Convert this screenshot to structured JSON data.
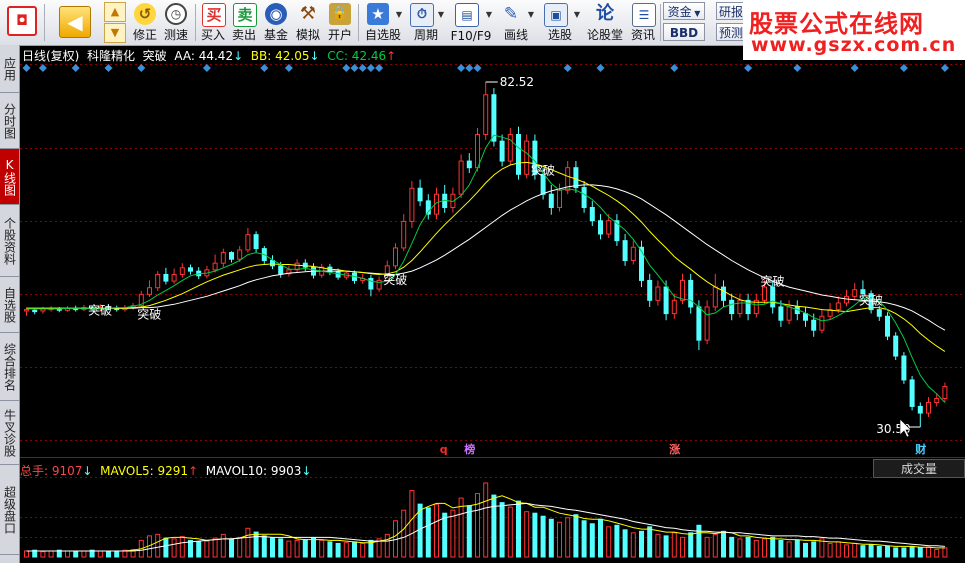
{
  "toolbar": {
    "items": [
      {
        "id": "back",
        "label": ""
      },
      {
        "id": "fix",
        "label": "修正"
      },
      {
        "id": "speed",
        "label": "测速"
      },
      {
        "id": "buy",
        "label": "买入",
        "glyph": "买"
      },
      {
        "id": "sell",
        "label": "卖出",
        "glyph": "卖"
      },
      {
        "id": "fund",
        "label": "基金"
      },
      {
        "id": "sim",
        "label": "模拟"
      },
      {
        "id": "open",
        "label": "开户"
      },
      {
        "id": "watch",
        "label": "自选股"
      },
      {
        "id": "period",
        "label": "周期"
      },
      {
        "id": "f10",
        "label": "F10/F9"
      },
      {
        "id": "draw",
        "label": "画线"
      },
      {
        "id": "pick",
        "label": "选股"
      },
      {
        "id": "forum",
        "label": "论股堂",
        "glyph": "论"
      },
      {
        "id": "news",
        "label": "资讯"
      }
    ],
    "funds_label": "资金",
    "bbd_label": "BBD",
    "research_label": "研报",
    "forecast_label": "预测"
  },
  "brand": {
    "title": "股票公式在线网",
    "url": "www.gszx.com.cn"
  },
  "sidebar": {
    "tabs": [
      {
        "label": "应用"
      },
      {
        "label": "分时图"
      },
      {
        "label": "K线图",
        "active": true
      },
      {
        "label": "个股资料"
      },
      {
        "label": "自选股"
      },
      {
        "label": "综合排名"
      },
      {
        "label": "牛叉诊股"
      },
      {
        "label": "超级盘口"
      }
    ]
  },
  "header": {
    "period": "日线(复权)",
    "stock": "科隆精化",
    "formula": "突破",
    "aa": "AA: 44.42",
    "bb": "BB: 42.05",
    "cc": "CC: 42.46"
  },
  "volume_header": {
    "total": "总手: 9107",
    "ma5": "MAVOL5: 9291",
    "ma10": "MAVOL10: 9903"
  },
  "volume_tab": "成交量",
  "labels": {
    "high": "82.52",
    "low": "30.50",
    "breakout": "突破",
    "marker_q": "q",
    "marker_bang": "榜",
    "marker_zhang": "涨",
    "marker_cai": "财"
  },
  "colors": {
    "up": "#ff3232",
    "down": "#54ffff",
    "ma_white": "#ffffff",
    "ma_yellow": "#ffff00",
    "ma_green": "#00cc44",
    "diamond": "#3a8fd8",
    "grid": "#8b0000",
    "header_white": "#ffffff",
    "aa_color": "#ffffff",
    "bb_color": "#ffff00",
    "cc_color": "#00cc44"
  },
  "chart_data": {
    "type": "candlestick",
    "y_range": [
      30.5,
      82.52
    ],
    "high_label": 82.52,
    "low_label": 30.5,
    "candles": [
      [
        48,
        48.2,
        47.3,
        48.5
      ],
      [
        48.1,
        47.9,
        47.5,
        48.4
      ],
      [
        48,
        48.3,
        47.6,
        48.6
      ],
      [
        48.2,
        48.4,
        47.9,
        48.7
      ],
      [
        48.3,
        48.1,
        47.8,
        48.6
      ],
      [
        48.1,
        48.4,
        47.9,
        48.7
      ],
      [
        48.4,
        48.2,
        47.9,
        48.8
      ],
      [
        48.2,
        48.5,
        48,
        48.9
      ],
      [
        48.5,
        48.3,
        48,
        48.8
      ],
      [
        48.3,
        48.6,
        48,
        49
      ],
      [
        48.6,
        48.4,
        48.1,
        49
      ],
      [
        48.4,
        48.2,
        47.9,
        48.8
      ],
      [
        48.2,
        48.5,
        47.9,
        48.9
      ],
      [
        48.5,
        48.8,
        48.2,
        49.2
      ],
      [
        48.8,
        50.5,
        48.6,
        51
      ],
      [
        50.5,
        51.5,
        50.1,
        52.6
      ],
      [
        51.5,
        53.5,
        51,
        54
      ],
      [
        53.5,
        52.5,
        52,
        54.5
      ],
      [
        52.5,
        53.5,
        52.1,
        54.4
      ],
      [
        53.5,
        54.5,
        53,
        55.2
      ],
      [
        54.5,
        54,
        53.5,
        55
      ],
      [
        54,
        53.3,
        52.8,
        54.6
      ],
      [
        53.3,
        54.2,
        52.9,
        54.8
      ],
      [
        54.2,
        55.2,
        53.8,
        56.5
      ],
      [
        55.2,
        56.8,
        54.6,
        57.4
      ],
      [
        56.8,
        55.8,
        55.3,
        57
      ],
      [
        55.8,
        57.2,
        55.4,
        57.8
      ],
      [
        57.2,
        59.5,
        56.8,
        60.5
      ],
      [
        59.5,
        57.4,
        56.8,
        60
      ],
      [
        57.4,
        55.6,
        55.1,
        57.8
      ],
      [
        55.6,
        54.8,
        54.3,
        56.4
      ],
      [
        54.8,
        53.6,
        53,
        55.4
      ],
      [
        53.6,
        54.2,
        53.2,
        54.8
      ],
      [
        54.2,
        55.2,
        53.8,
        55.8
      ],
      [
        55.2,
        54.6,
        54,
        55.8
      ],
      [
        54.6,
        53.4,
        52.9,
        55.2
      ],
      [
        53.4,
        54.6,
        53,
        55.1
      ],
      [
        54.6,
        53.9,
        53.4,
        55.1
      ],
      [
        53.9,
        53.1,
        52.7,
        54.4
      ],
      [
        53.1,
        53.7,
        52.7,
        54.1
      ],
      [
        53.7,
        52.6,
        52.1,
        54.1
      ],
      [
        52.6,
        52.9,
        52.1,
        53.6
      ],
      [
        52.9,
        51.3,
        50.2,
        53.4
      ],
      [
        51.3,
        52.6,
        50.9,
        53.2
      ],
      [
        52.6,
        54.8,
        52.2,
        55.6
      ],
      [
        54.8,
        57.5,
        54.3,
        58.2
      ],
      [
        57.5,
        61.5,
        57,
        62.6
      ],
      [
        61.5,
        66.5,
        60.5,
        67.6
      ],
      [
        66.5,
        64.6,
        63.8,
        67.8
      ],
      [
        64.6,
        62.6,
        61.8,
        65.6
      ],
      [
        62.6,
        65.6,
        61.8,
        66.6
      ],
      [
        65.6,
        63.6,
        62.8,
        67
      ],
      [
        63.6,
        65.6,
        62.8,
        66.6
      ],
      [
        65.6,
        70.6,
        65,
        71.6
      ],
      [
        70.6,
        69.6,
        68.8,
        71.8
      ],
      [
        69.6,
        74.6,
        69,
        75.6
      ],
      [
        74.6,
        80.6,
        73.8,
        82.52
      ],
      [
        80.6,
        73.6,
        72.8,
        81.6
      ],
      [
        73.6,
        70.6,
        69.8,
        74.6
      ],
      [
        70.6,
        74.6,
        70,
        75.6
      ],
      [
        74.6,
        68.6,
        67.8,
        75.8
      ],
      [
        68.6,
        73.6,
        68,
        74.6
      ],
      [
        73.6,
        68.6,
        67.8,
        74.6
      ],
      [
        68.6,
        65.6,
        64.8,
        69.6
      ],
      [
        65.6,
        63.6,
        62.5,
        67
      ],
      [
        63.6,
        66.2,
        63,
        67.2
      ],
      [
        66.2,
        69.6,
        65.6,
        70.6
      ],
      [
        69.6,
        66.6,
        65.8,
        70.6
      ],
      [
        66.6,
        63.6,
        62.8,
        67.6
      ],
      [
        63.6,
        61.6,
        60.8,
        64.6
      ],
      [
        61.6,
        59.6,
        58.8,
        62.6
      ],
      [
        59.6,
        61.6,
        59,
        62.6
      ],
      [
        61.6,
        58.6,
        57.8,
        62.6
      ],
      [
        58.6,
        55.6,
        54.8,
        59.6
      ],
      [
        55.6,
        57.6,
        55,
        58.6
      ],
      [
        57.6,
        52.6,
        51.6,
        58.6
      ],
      [
        52.6,
        49.6,
        48.6,
        53.6
      ],
      [
        49.6,
        51.6,
        48.8,
        52.6
      ],
      [
        51.6,
        47.6,
        46.6,
        52.6
      ],
      [
        47.6,
        49.6,
        46.8,
        50.6
      ],
      [
        49.6,
        52.6,
        49,
        53.6
      ],
      [
        52.6,
        48.6,
        47.6,
        53.6
      ],
      [
        48.6,
        43.6,
        42.1,
        49.6
      ],
      [
        43.6,
        48.6,
        43,
        49.6
      ],
      [
        48.6,
        51.6,
        48,
        53.6
      ],
      [
        51.6,
        49.6,
        48.6,
        52.6
      ],
      [
        49.6,
        47.6,
        46.6,
        50.6
      ],
      [
        47.6,
        49.6,
        47,
        50.6
      ],
      [
        49.6,
        47.6,
        46.6,
        50.6
      ],
      [
        47.6,
        49.6,
        47,
        50.6
      ],
      [
        49.6,
        51.6,
        49,
        52.6
      ],
      [
        51.6,
        48.6,
        47.6,
        52.6
      ],
      [
        48.6,
        46.6,
        45.6,
        49.6
      ],
      [
        46.6,
        48.6,
        46,
        49.6
      ],
      [
        48.6,
        47.6,
        46.6,
        49.6
      ],
      [
        47.6,
        46.6,
        45.6,
        48.6
      ],
      [
        46.6,
        45.1,
        44.1,
        47.6
      ],
      [
        45.1,
        47.2,
        44.6,
        48.2
      ],
      [
        47.2,
        48.2,
        46.7,
        49.2
      ],
      [
        48.2,
        49.2,
        47.7,
        50.2
      ],
      [
        49.2,
        50.2,
        48.7,
        51.2
      ],
      [
        50.2,
        51.2,
        49.7,
        52.2
      ],
      [
        51.2,
        50.6,
        50.1,
        52.6
      ],
      [
        50.6,
        48.2,
        47.6,
        51.1
      ],
      [
        48.2,
        47.2,
        46.5,
        48.8
      ],
      [
        47.2,
        44.2,
        43.6,
        47.8
      ],
      [
        44.2,
        41.2,
        40.6,
        44.8
      ],
      [
        41.2,
        37.6,
        37,
        41.8
      ],
      [
        37.6,
        33.6,
        33,
        38.2
      ],
      [
        33.6,
        32.6,
        30.5,
        34.2
      ],
      [
        32.6,
        34.2,
        32,
        35
      ],
      [
        34.2,
        34.8,
        33.6,
        35.6
      ],
      [
        34.8,
        36.6,
        34.2,
        37.2
      ]
    ],
    "ma_short": [
      48.3,
      48.3,
      48.3,
      48.3,
      48.3,
      48.4,
      48.4,
      48.4,
      48.4,
      48.4,
      48.4,
      48.5,
      48.5,
      48.7,
      49,
      49.6,
      50.4,
      51.1,
      51.8,
      52.6,
      53.3,
      53.6,
      53.7,
      54,
      54.5,
      55,
      55.6,
      56.5,
      56.8,
      56.5,
      55.7,
      55,
      54.3,
      54.3,
      54.4,
      54.2,
      54,
      53.8,
      53.6,
      53.4,
      53.2,
      52.9,
      52.5,
      52.3,
      52.5,
      53.5,
      55.5,
      58.2,
      61,
      63,
      64.3,
      64.7,
      64.5,
      65.4,
      67,
      69.5,
      72.6,
      74.5,
      74.2,
      73.8,
      72.6,
      71.8,
      70.6,
      68.8,
      67.2,
      66.2,
      66.4,
      66.2,
      65.6,
      64.8,
      63.6,
      62.2,
      61.2,
      60.2,
      58.8,
      57,
      54.9,
      53.4,
      51.8,
      50.2,
      49.8,
      49.6,
      48.6,
      47.4,
      47.7,
      48.6,
      49,
      49.2,
      49.2,
      48.9,
      49,
      49.5,
      49.1,
      48.6,
      48.2,
      47.7,
      47,
      46.5,
      46.7,
      47.3,
      48,
      48.9,
      49.9,
      50,
      49.5,
      48.1,
      46.2,
      43.9,
      41,
      38.3,
      36.6,
      35.5,
      34.2
    ],
    "ma_mid": [
      48.4,
      48.4,
      48.4,
      48.4,
      48.4,
      48.4,
      48.4,
      48.4,
      48.4,
      48.4,
      48.4,
      48.4,
      48.4,
      48.5,
      48.6,
      48.8,
      49.2,
      49.6,
      50.1,
      50.6,
      51.2,
      51.8,
      52.4,
      52.9,
      53.4,
      53.8,
      54.2,
      54.6,
      54.9,
      55,
      55.1,
      55,
      55,
      54.9,
      54.8,
      54.7,
      54.5,
      54.3,
      54.2,
      54,
      53.9,
      53.8,
      53.6,
      53.5,
      53.6,
      53.9,
      54.6,
      55.6,
      56.9,
      58.3,
      59.7,
      61,
      62.2,
      63.4,
      64.6,
      65.9,
      67.3,
      68.5,
      69.4,
      70,
      70.3,
      70.4,
      70.2,
      69.8,
      69.3,
      68.8,
      68.3,
      67.9,
      67.4,
      66.8,
      66.1,
      65.4,
      64.6,
      63.7,
      62.6,
      61.4,
      60,
      58.7,
      57.5,
      56.2,
      55.2,
      54.3,
      53.3,
      52.4,
      51.6,
      51,
      50.3,
      49.7,
      49.4,
      49.3,
      49.3,
      49.3,
      49.1,
      48.9,
      48.7,
      48.6,
      48.4,
      48.2,
      48.1,
      48,
      47.9,
      48.1,
      48.3,
      48.5,
      48.5,
      48.2,
      47.6,
      46.8,
      45.8,
      44.6,
      43.6,
      42.7,
      41.9
    ],
    "ma_long": [
      48.4,
      48.4,
      48.4,
      48.4,
      48.4,
      48.4,
      48.4,
      48.4,
      48.4,
      48.4,
      48.4,
      48.4,
      48.4,
      48.4,
      48.5,
      48.5,
      48.6,
      48.8,
      49,
      49.3,
      49.6,
      49.9,
      50.2,
      50.6,
      51,
      51.4,
      51.8,
      52.3,
      52.7,
      53,
      53.3,
      53.5,
      53.7,
      53.8,
      53.9,
      54,
      54,
      54,
      54,
      54,
      53.9,
      53.8,
      53.7,
      53.6,
      53.5,
      53.5,
      53.7,
      54,
      54.5,
      55.1,
      55.7,
      56.4,
      57.2,
      58,
      58.8,
      59.7,
      60.6,
      61.5,
      62.4,
      63.2,
      63.9,
      64.6,
      65.2,
      65.7,
      66.1,
      66.4,
      66.7,
      66.9,
      67,
      67,
      66.9,
      66.7,
      66.4,
      66,
      65.5,
      64.9,
      64.1,
      63.3,
      62.5,
      61.6,
      60.7,
      59.8,
      58.9,
      58,
      57.2,
      56.4,
      55.6,
      54.9,
      54.2,
      53.6,
      53,
      52.5,
      52,
      51.6,
      51.3,
      51,
      50.7,
      50.4,
      50.2,
      50,
      49.8,
      49.7,
      49.6,
      49.5,
      49.4,
      49.2,
      48.9,
      48.5,
      48,
      47.3,
      46.6,
      45.8,
      45.1
    ],
    "volume": [
      8,
      9,
      7,
      8,
      9,
      8,
      7,
      8,
      9,
      8,
      7,
      8,
      9,
      10,
      22,
      28,
      30,
      25,
      24,
      27,
      22,
      20,
      21,
      25,
      30,
      24,
      26,
      38,
      33,
      28,
      25,
      24,
      21,
      22,
      23,
      25,
      22,
      20,
      18,
      19,
      20,
      18,
      22,
      24,
      30,
      48,
      62,
      88,
      70,
      65,
      70,
      58,
      62,
      78,
      68,
      84,
      98,
      82,
      72,
      66,
      74,
      60,
      58,
      54,
      50,
      46,
      52,
      56,
      48,
      44,
      50,
      40,
      42,
      36,
      32,
      34,
      40,
      30,
      28,
      32,
      26,
      32,
      42,
      26,
      30,
      34,
      26,
      24,
      26,
      22,
      24,
      26,
      22,
      20,
      22,
      18,
      20,
      24,
      18,
      20,
      16,
      18,
      15,
      16,
      14,
      14,
      12,
      12,
      14,
      12,
      13,
      10,
      12
    ],
    "vol_ma5": [
      8,
      8,
      8,
      8,
      8,
      8,
      8,
      8,
      8,
      8,
      8,
      8,
      8,
      9,
      11,
      15,
      20,
      25,
      26,
      26,
      25,
      24,
      22,
      23,
      24,
      24,
      25,
      29,
      30,
      30,
      30,
      30,
      28,
      24,
      23,
      23,
      23,
      22,
      22,
      21,
      20,
      19,
      19,
      21,
      23,
      28,
      37,
      50,
      62,
      67,
      71,
      71,
      65,
      67,
      68,
      70,
      74,
      78,
      81,
      77,
      72,
      71,
      66,
      66,
      62,
      58,
      56,
      54,
      51,
      50,
      50,
      48,
      45,
      42,
      39,
      37,
      37,
      35,
      33,
      33,
      31,
      30,
      32,
      32,
      31,
      33,
      32,
      28,
      28,
      26,
      25,
      24,
      24,
      23,
      23,
      22,
      22,
      21,
      20,
      20,
      19,
      18,
      17,
      17,
      16,
      15,
      14,
      14,
      14,
      13,
      13,
      12,
      12
    ],
    "vol_ma10": [
      8,
      8,
      8,
      8,
      8,
      8,
      8,
      8,
      8,
      8,
      8,
      8,
      8,
      8,
      9,
      11,
      13,
      15,
      17,
      19,
      20,
      21,
      22,
      23,
      24,
      24,
      25,
      26,
      27,
      27,
      26,
      26,
      26,
      26,
      26,
      26,
      26,
      26,
      25,
      24,
      23,
      22,
      21,
      21,
      21,
      23,
      26,
      31,
      37,
      42,
      47,
      52,
      54,
      57,
      60,
      62,
      65,
      67,
      68,
      69,
      70,
      71,
      69,
      68,
      67,
      65,
      63,
      62,
      60,
      58,
      56,
      54,
      52,
      50,
      47,
      45,
      43,
      41,
      39,
      38,
      36,
      35,
      34,
      34,
      33,
      33,
      32,
      32,
      31,
      30,
      29,
      28,
      28,
      28,
      28,
      27,
      27,
      26,
      25,
      25,
      24,
      23,
      22,
      21,
      21,
      20,
      19,
      18,
      17,
      16,
      15,
      15,
      14
    ]
  },
  "signals": {
    "breakouts": [
      {
        "index": 8,
        "price": 48.2,
        "label_key": "breakout"
      },
      {
        "index": 14,
        "price": 47.6,
        "label_key": "breakout"
      },
      {
        "index": 44,
        "price": 52.8,
        "label_key": "breakout"
      },
      {
        "index": 62,
        "price": 69.3,
        "label_key": "breakout"
      },
      {
        "index": 90,
        "price": 52.6,
        "label_key": "breakout"
      },
      {
        "index": 102,
        "price": 49.7,
        "label_key": "breakout"
      }
    ],
    "diamond_indices": [
      0,
      2,
      6,
      10,
      14,
      22,
      29,
      32,
      39,
      40,
      41,
      42,
      43,
      53,
      54,
      55,
      66,
      70,
      79,
      88,
      94,
      101,
      107,
      112
    ],
    "markers": [
      {
        "index": 51,
        "key": "marker_q",
        "color": "#ff2a2a"
      },
      {
        "index": 54,
        "key": "marker_bang",
        "color": "#d070ff"
      },
      {
        "index": 79,
        "key": "marker_zhang",
        "color": "#ff6060"
      },
      {
        "index": 109,
        "key": "marker_cai",
        "color": "#49d0ff"
      }
    ]
  }
}
